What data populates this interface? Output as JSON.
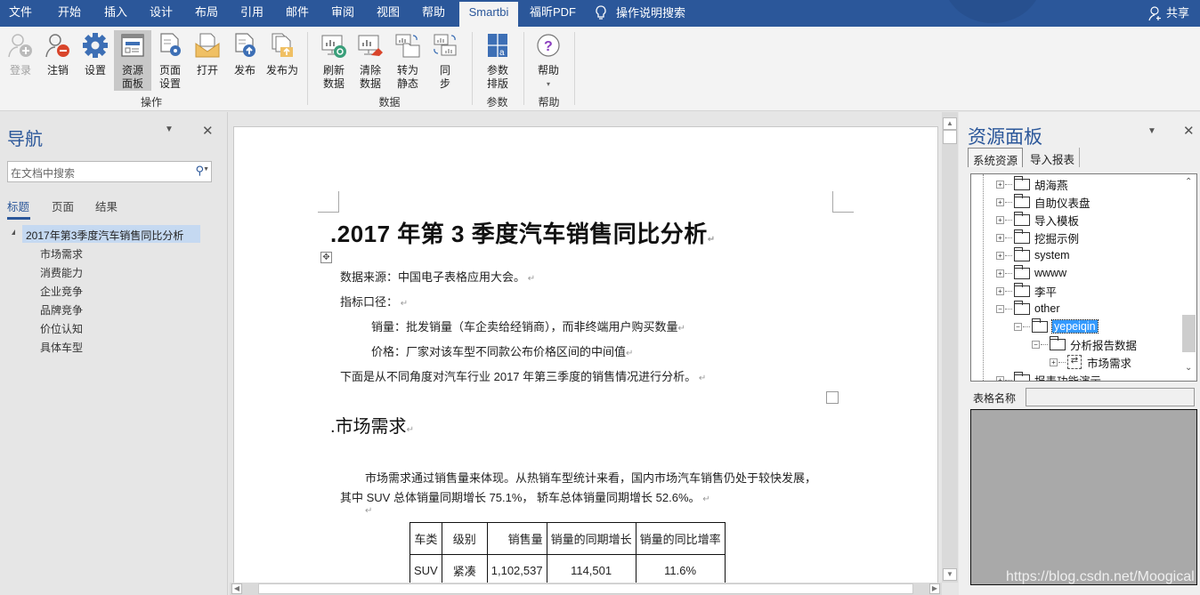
{
  "menu_tabs": [
    {
      "label": "文件",
      "active": false
    },
    {
      "label": "开始",
      "active": false
    },
    {
      "label": "插入",
      "active": false
    },
    {
      "label": "设计",
      "active": false
    },
    {
      "label": "布局",
      "active": false
    },
    {
      "label": "引用",
      "active": false
    },
    {
      "label": "邮件",
      "active": false
    },
    {
      "label": "审阅",
      "active": false
    },
    {
      "label": "视图",
      "active": false
    },
    {
      "label": "帮助",
      "active": false
    },
    {
      "label": "Smartbi",
      "active": true
    },
    {
      "label": "福昕PDF",
      "active": false
    }
  ],
  "tell_me": "操作说明搜索",
  "share_label": "共享",
  "ribbon": {
    "groups": [
      {
        "label": "操作",
        "buttons": [
          {
            "label": "登录",
            "icon": "login-user-icon",
            "disabled": true
          },
          {
            "label": "注销",
            "icon": "logout-user-icon"
          },
          {
            "label": "设置",
            "icon": "gear-icon"
          },
          {
            "label": "资源\n面板",
            "line1": "资源",
            "line2": "面板",
            "icon": "resource-panel-icon",
            "active": true
          },
          {
            "label": "页面设置",
            "line1": "页面",
            "line2": "设置",
            "icon": "page-settings-icon"
          },
          {
            "label": "打开",
            "icon": "open-envelope-icon"
          },
          {
            "label": "发布",
            "icon": "publish-icon"
          },
          {
            "label": "发布为",
            "icon": "publish-as-icon"
          }
        ]
      },
      {
        "label": "数据",
        "buttons": [
          {
            "label": "刷新数据",
            "line1": "刷新",
            "line2": "数据",
            "icon": "refresh-data-icon"
          },
          {
            "label": "清除数据",
            "line1": "清除",
            "line2": "数据",
            "icon": "clear-data-icon"
          },
          {
            "label": "转为静态",
            "line1": "转为",
            "line2": "静态",
            "icon": "to-static-icon"
          },
          {
            "label": "同步",
            "line1": "同",
            "line2": "步",
            "icon": "sync-icon"
          }
        ]
      },
      {
        "label": "参数",
        "buttons": [
          {
            "label": "参数排版",
            "line1": "参数",
            "line2": "排版",
            "icon": "param-layout-icon"
          }
        ]
      },
      {
        "label": "帮助",
        "buttons": [
          {
            "label": "帮助",
            "icon": "help-question-icon",
            "dropdown": true
          }
        ]
      }
    ]
  },
  "nav": {
    "title": "导航",
    "search_placeholder": "在文档中搜索",
    "tabs": [
      {
        "label": "标题",
        "active": true
      },
      {
        "label": "页面"
      },
      {
        "label": "结果"
      }
    ],
    "root": "2017年第3季度汽车销售同比分析",
    "items": [
      "市场需求",
      "消费能力",
      "企业竞争",
      "品牌竞争",
      "价位认知",
      "具体车型"
    ]
  },
  "document": {
    "title": "2017 年第 3 季度汽车销售同比分析",
    "lines": [
      "数据来源：中国电子表格应用大会。",
      "指标口径：",
      "销量：批发销量（车企卖给经销商），而非终端用户购买数量",
      "价格：厂家对该车型不同款公布价格区间的中间值",
      "下面是从不同角度对汽车行业 2017 年第三季度的销售情况进行分析。"
    ],
    "section_title": "市场需求",
    "section_para1": "市场需求通过销售量来体现。从热销车型统计来看，国内市场汽车销售仍处于较快发展，",
    "section_para2": "其中 SUV 总体销量同期增长 75.1%， 轿车总体销量同期增长 52.6%。",
    "table": {
      "headers": [
        "车类",
        "级别",
        "销售量",
        "销量的同期增长",
        "销量的同比增率"
      ],
      "rows": [
        [
          "SUV",
          "紧凑",
          "1,102,537",
          "114,501",
          "11.6%"
        ]
      ]
    }
  },
  "resource_panel": {
    "title": "资源面板",
    "tabs": [
      {
        "label": "系统资源",
        "active": true
      },
      {
        "label": "导入报表"
      }
    ],
    "tree": [
      {
        "label": "胡海燕",
        "level": 0,
        "expander": "+"
      },
      {
        "label": "自助仪表盘",
        "level": 0,
        "expander": "+"
      },
      {
        "label": "导入模板",
        "level": 0,
        "expander": "+"
      },
      {
        "label": "挖掘示例",
        "level": 0,
        "expander": "+"
      },
      {
        "label": "system",
        "level": 0,
        "expander": "+"
      },
      {
        "label": "wwww",
        "level": 0,
        "expander": "+"
      },
      {
        "label": "李平",
        "level": 0,
        "expander": "+"
      },
      {
        "label": "other",
        "level": 0,
        "expander": "-"
      },
      {
        "label": "yepeiqin",
        "level": 1,
        "expander": "-",
        "selected": true
      },
      {
        "label": "分析报告数据",
        "level": 2,
        "expander": "-"
      },
      {
        "label": "市场需求",
        "level": 3,
        "expander": "+",
        "type": "report"
      },
      {
        "label": "报表功能演示",
        "level": 0,
        "expander": "+"
      }
    ],
    "table_name_label": "表格名称",
    "table_name_value": ""
  },
  "watermark": "https://blog.csdn.net/Moogical"
}
